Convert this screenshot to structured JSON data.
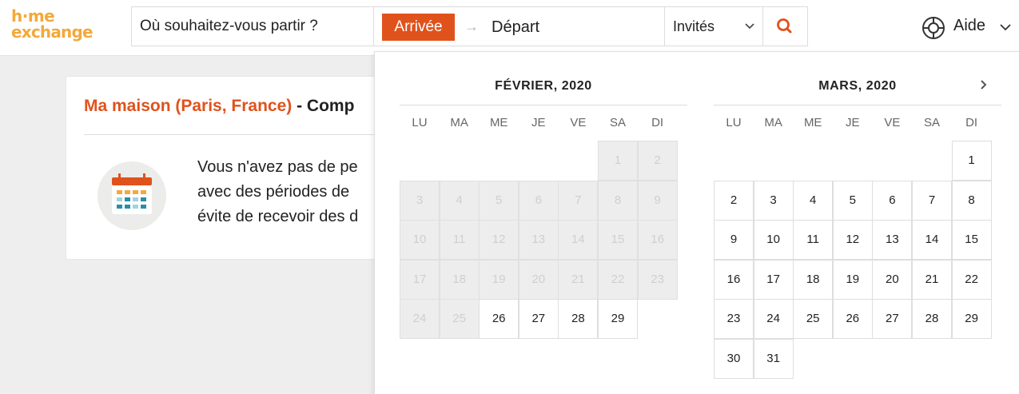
{
  "header": {
    "logo_line1": "h·me",
    "logo_line2": "exchange",
    "destination_placeholder": "Où souhaitez-vous partir ?",
    "arrival_label": "Arrivée",
    "arrow": "→",
    "departure_label": "Départ",
    "guests_label": "Invités",
    "help_label": "Aide"
  },
  "card": {
    "title_home": "Ma maison (Paris, France)",
    "title_rest": " - Comp",
    "text_lines": [
      "Vous n'avez pas de pe",
      "avec des périodes de",
      "évite de recevoir des d"
    ]
  },
  "calendar": {
    "weekdays": [
      "LU",
      "MA",
      "ME",
      "JE",
      "VE",
      "SA",
      "DI"
    ],
    "months": [
      {
        "title": "FÉVRIER, 2020",
        "first_weekday_index": 5,
        "days_in_month": 29,
        "first_available_day": 26
      },
      {
        "title": "MARS, 2020",
        "first_weekday_index": 6,
        "days_in_month": 31,
        "first_available_day": 1
      }
    ]
  },
  "colors": {
    "brand_orange": "#e0521c",
    "logo_yellow": "#f2a93b",
    "disabled_day_bg": "#ededed"
  }
}
